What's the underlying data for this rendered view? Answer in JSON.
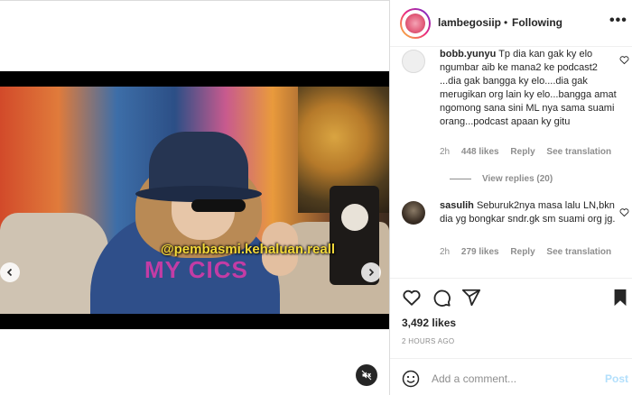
{
  "post": {
    "username": "lambegosiip",
    "separator": "•",
    "follow_state": "Following",
    "more_label": "•••"
  },
  "video": {
    "watermark": "@pembasmi.kehaluan.reall",
    "brand_text": "MY CICS"
  },
  "comments": [
    {
      "user": "bobb.yunyu",
      "text": "Tp dia kan gak ky elo ngumbar aib ke mana2 ke podcast2 ...dia gak bangga ky elo....dia gak merugikan org lain ky elo...bangga amat ngomong sana sini ML nya sama suami orang...podcast apaan ky gitu",
      "time": "2h",
      "likes": "448 likes",
      "reply": "Reply",
      "translate": "See translation",
      "view_replies": "View replies (20)"
    },
    {
      "user": "sasulih",
      "text": "Seburuk2nya masa lalu LN,bkn dia yg bongkar sndr.gk sm suami org jg.",
      "time": "2h",
      "likes": "279 likes",
      "reply": "Reply",
      "translate": "See translation"
    }
  ],
  "stats": {
    "likes": "3,492 likes",
    "time_ago": "2 HOURS AGO"
  },
  "composer": {
    "placeholder": "Add a comment...",
    "post_label": "Post"
  },
  "icons": {
    "heart": "heart-icon",
    "comment": "comment-icon",
    "share": "share-icon",
    "save": "bookmark-icon",
    "emoji": "emoji-icon",
    "mute": "mute-icon",
    "prev": "chevron-left-icon",
    "next": "chevron-right-icon"
  },
  "colors": {
    "post_disabled": "#b2dffc",
    "muted_text": "#8e8e8e",
    "watermark": "#f4d93a"
  }
}
